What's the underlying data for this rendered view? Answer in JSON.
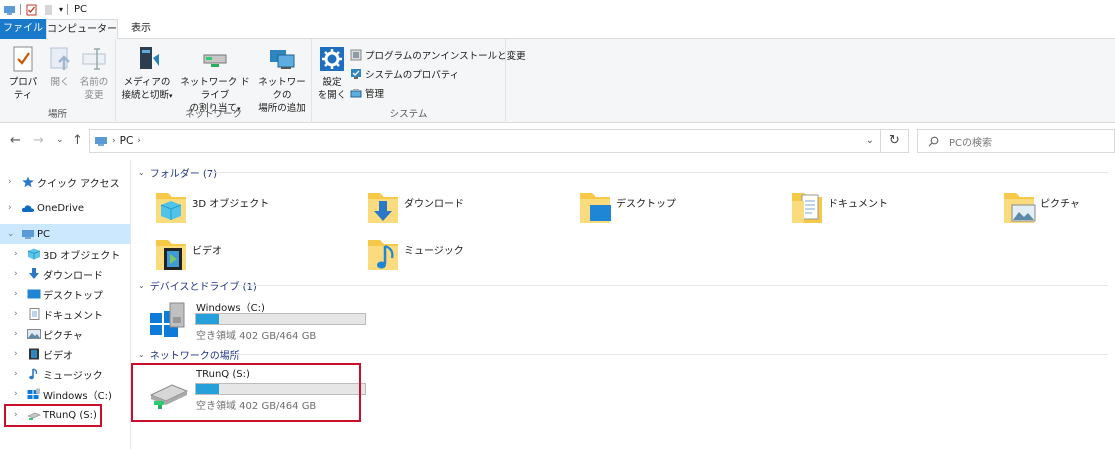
{
  "window": {
    "title": "PC"
  },
  "tabs": {
    "file": "ファイル",
    "computer": "コンピューター",
    "view": "表示"
  },
  "ribbon": {
    "location_group": {
      "label": "場所",
      "properties": "プロパティ",
      "open": "開く",
      "rename_line1": "名前の",
      "rename_line2": "変更"
    },
    "network_group": {
      "label": "ネットワーク",
      "media_line1": "メディアの",
      "media_line2": "接続と切断",
      "map_line1": "ネットワーク ドライブ",
      "map_line2": "の割り当て",
      "add_line1": "ネットワークの",
      "add_line2": "場所の追加"
    },
    "system_group": {
      "label": "システム",
      "settings_line1": "設定",
      "settings_line2": "を開く",
      "uninstall": "プログラムのアンインストールと変更",
      "sys_props": "システムのプロパティ",
      "manage": "管理"
    }
  },
  "address": {
    "crumb": "PC",
    "search_placeholder": "PCの検索"
  },
  "nav": {
    "quick_access": "クイック アクセス",
    "onedrive": "OneDrive",
    "pc": "PC",
    "objects3d": "3D オブジェクト",
    "downloads": "ダウンロード",
    "desktop": "デスクトップ",
    "documents": "ドキュメント",
    "pictures": "ピクチャ",
    "videos": "ビデオ",
    "music": "ミュージック",
    "windows_c": "Windows（C:)",
    "trunq": "TRunQ (S:)"
  },
  "sections": {
    "folders": "フォルダー (7)",
    "devices": "デバイスとドライブ (1)",
    "network": "ネットワークの場所"
  },
  "folders": {
    "objects3d": "3D オブジェクト",
    "downloads": "ダウンロード",
    "desktop": "デスクトップ",
    "documents": "ドキュメント",
    "pictures": "ピクチャ",
    "videos": "ビデオ",
    "music": "ミュージック"
  },
  "drives": {
    "c": {
      "name": "Windows（C:)",
      "free": "空き領域 402 GB/464 GB",
      "used_fraction": 0.134
    },
    "s": {
      "name": "TRunQ (S:)",
      "free": "空き領域 402 GB/464 GB",
      "used_fraction": 0.134
    }
  },
  "colors": {
    "accent": "#1979ca",
    "bar_fill": "#26a0da",
    "highlight": "#c8102e",
    "selected_nav": "#cce8ff"
  }
}
